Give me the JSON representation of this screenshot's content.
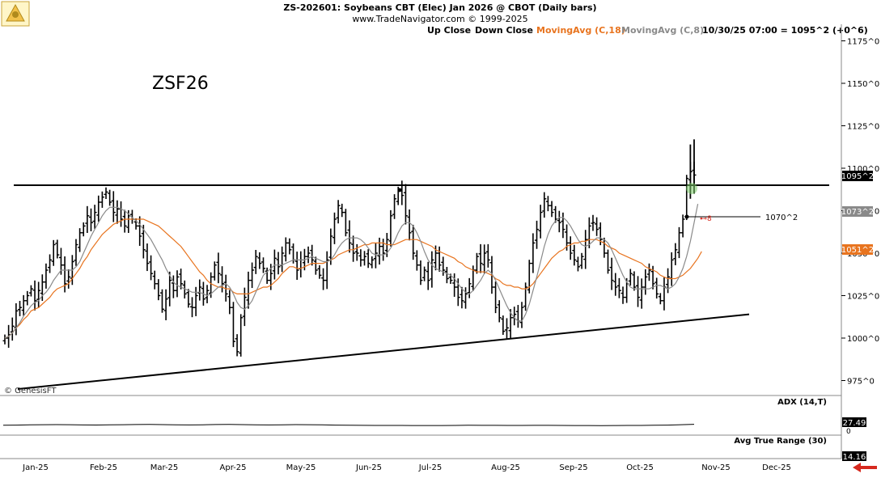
{
  "header": {
    "title": "ZS-202601:  Soybeans CBT (Elec) Jan 2026 @ CBOT  (Daily bars)",
    "subtitle": "www.TradeNavigator.com © 1999-2025"
  },
  "legend": {
    "up_close": "Up Close",
    "down_close": "Down Close",
    "ma18": "MovingAvg (C,18)",
    "ma8": "MovingAvg (C,8)",
    "last_quote": "10/30/25 07:00 = 1095^2 (+0^6)"
  },
  "colors": {
    "bars": "#000000",
    "ma18": "#e8741f",
    "ma8": "#8a8a8a",
    "adx": "#000000",
    "price_tag_bg": "#000000",
    "ma8_tag_bg": "#8a8a8a",
    "ma18_tag_bg": "#e8741f",
    "highlight": "#7ccc6a",
    "nav_arrow": "#d6291e"
  },
  "annotation_symbol": "ZSF26",
  "annotation_level": "1070^2",
  "watermark": "© GenesisFT",
  "chart_data": [
    {
      "type": "bar",
      "subtype": "ohlc",
      "title": "ZS-202601:  Soybeans CBT (Elec) Jan 2026 @ CBOT  (Daily bars)",
      "x_ticks": [
        "Jan-25",
        "Feb-25",
        "Mar-25",
        "Apr-25",
        "May-25",
        "Jun-25",
        "Jul-25",
        "Aug-25",
        "Sep-25",
        "Oct-25",
        "Nov-25",
        "Dec-25"
      ],
      "y_ticks": [
        "975^0",
        "1000^0",
        "1025^0",
        "1050^0",
        "1075^0",
        "1100^0",
        "1125^0",
        "1150^0",
        "1175^0"
      ],
      "ylim": [
        970,
        1190
      ],
      "grid": false,
      "series": [
        {
          "name": "Close",
          "values": [
            1000,
            1002,
            1007,
            1016,
            1018,
            1022,
            1025,
            1029,
            1022,
            1028,
            1033,
            1040,
            1046,
            1055,
            1049,
            1043,
            1032,
            1036,
            1045,
            1055,
            1062,
            1066,
            1072,
            1068,
            1074,
            1080,
            1083,
            1086,
            1080,
            1074,
            1076,
            1070,
            1066,
            1072,
            1070,
            1066,
            1060,
            1052,
            1044,
            1038,
            1032,
            1025,
            1017,
            1023,
            1034,
            1028,
            1036,
            1032,
            1026,
            1020,
            1018,
            1025,
            1030,
            1023,
            1028,
            1036,
            1043,
            1038,
            1032,
            1026,
            1018,
            998,
            992,
            1012,
            1024,
            1034,
            1040,
            1048,
            1044,
            1041,
            1034,
            1038,
            1047,
            1042,
            1050,
            1056,
            1052,
            1046,
            1040,
            1046,
            1048,
            1050,
            1046,
            1040,
            1037,
            1034,
            1046,
            1060,
            1070,
            1078,
            1074,
            1062,
            1056,
            1050,
            1050,
            1046,
            1048,
            1044,
            1046,
            1050,
            1054,
            1050,
            1058,
            1072,
            1082,
            1087,
            1084,
            1072,
            1062,
            1050,
            1043,
            1034,
            1040,
            1034,
            1046,
            1050,
            1043,
            1040,
            1035,
            1034,
            1030,
            1024,
            1022,
            1026,
            1032,
            1040,
            1048,
            1044,
            1050,
            1046,
            1030,
            1018,
            1012,
            1004,
            1006,
            1012,
            1014,
            1010,
            1018,
            1030,
            1044,
            1056,
            1064,
            1074,
            1082,
            1078,
            1074,
            1070,
            1068,
            1064,
            1056,
            1050,
            1046,
            1042,
            1048,
            1058,
            1066,
            1068,
            1064,
            1058,
            1050,
            1040,
            1034,
            1030,
            1028,
            1024,
            1032,
            1038,
            1030,
            1024,
            1030,
            1036,
            1040,
            1032,
            1026,
            1022,
            1030,
            1036,
            1046,
            1052,
            1062,
            1070,
            1094,
            1098,
            1096
          ],
          "color": "#000000"
        },
        {
          "name": "MovingAvg (C,18)",
          "values": [
            1000,
            1001,
            1003,
            1006,
            1008,
            1011,
            1013,
            1016,
            1017,
            1018,
            1020,
            1022,
            1024,
            1027,
            1029,
            1030,
            1031,
            1032,
            1035,
            1038,
            1041,
            1045,
            1048,
            1052,
            1055,
            1058,
            1061,
            1063,
            1065,
            1067,
            1068,
            1069,
            1070,
            1070,
            1070,
            1070,
            1070,
            1070,
            1069,
            1068,
            1067,
            1066,
            1064,
            1062,
            1060,
            1058,
            1056,
            1054,
            1051,
            1048,
            1045,
            1042,
            1039,
            1037,
            1034,
            1032,
            1031,
            1030,
            1030,
            1029,
            1029,
            1027,
            1026,
            1026,
            1026,
            1026,
            1027,
            1028,
            1029,
            1030,
            1030,
            1031,
            1033,
            1035,
            1038,
            1040,
            1042,
            1042,
            1041,
            1041,
            1042,
            1043,
            1044,
            1044,
            1044,
            1044,
            1045,
            1046,
            1047,
            1049,
            1050,
            1051,
            1052,
            1052,
            1053,
            1054,
            1055,
            1055,
            1056,
            1056,
            1056,
            1056,
            1055,
            1055,
            1055,
            1056,
            1057,
            1058,
            1058,
            1058,
            1058,
            1057,
            1056,
            1055,
            1054,
            1052,
            1051,
            1050,
            1049,
            1048,
            1047,
            1045,
            1044,
            1042,
            1041,
            1040,
            1039,
            1039,
            1039,
            1038,
            1037,
            1035,
            1034,
            1032,
            1031,
            1031,
            1030,
            1030,
            1029,
            1029,
            1030,
            1032,
            1035,
            1038,
            1041,
            1044,
            1047,
            1049,
            1051,
            1052,
            1054,
            1055,
            1056,
            1056,
            1057,
            1057,
            1058,
            1058,
            1058,
            1057,
            1056,
            1054,
            1053,
            1052,
            1050,
            1049,
            1048,
            1047,
            1046,
            1045,
            1044,
            1042,
            1041,
            1040,
            1039,
            1037,
            1036,
            1035,
            1035,
            1035,
            1036,
            1037,
            1039,
            1041,
            1044,
            1047,
            1051
          ],
          "color": "#e8741f"
        },
        {
          "name": "MovingAvg (C,8)",
          "values": [
            1000,
            1001,
            1003,
            1006,
            1009,
            1013,
            1016,
            1019,
            1021,
            1022,
            1025,
            1027,
            1030,
            1034,
            1037,
            1040,
            1040,
            1040,
            1040,
            1042,
            1045,
            1050,
            1055,
            1060,
            1064,
            1068,
            1072,
            1075,
            1077,
            1077,
            1077,
            1076,
            1075,
            1073,
            1071,
            1069,
            1067,
            1064,
            1061,
            1058,
            1054,
            1050,
            1046,
            1041,
            1037,
            1033,
            1031,
            1030,
            1029,
            1028,
            1027,
            1027,
            1027,
            1026,
            1025,
            1026,
            1028,
            1030,
            1031,
            1032,
            1030,
            1026,
            1021,
            1018,
            1017,
            1019,
            1022,
            1027,
            1032,
            1037,
            1039,
            1041,
            1043,
            1043,
            1043,
            1044,
            1045,
            1046,
            1046,
            1046,
            1046,
            1047,
            1048,
            1047,
            1046,
            1045,
            1045,
            1046,
            1049,
            1053,
            1056,
            1058,
            1059,
            1059,
            1059,
            1058,
            1056,
            1053,
            1050,
            1049,
            1049,
            1049,
            1050,
            1053,
            1057,
            1062,
            1066,
            1068,
            1068,
            1066,
            1062,
            1057,
            1051,
            1046,
            1043,
            1041,
            1040,
            1039,
            1038,
            1037,
            1035,
            1032,
            1029,
            1027,
            1026,
            1028,
            1031,
            1034,
            1038,
            1040,
            1038,
            1034,
            1029,
            1024,
            1019,
            1015,
            1012,
            1010,
            1010,
            1014,
            1020,
            1028,
            1036,
            1045,
            1054,
            1061,
            1066,
            1069,
            1071,
            1071,
            1069,
            1066,
            1062,
            1058,
            1055,
            1054,
            1055,
            1057,
            1059,
            1059,
            1058,
            1056,
            1052,
            1047,
            1042,
            1037,
            1033,
            1030,
            1029,
            1029,
            1029,
            1029,
            1029,
            1030,
            1031,
            1031,
            1030,
            1029,
            1030,
            1032,
            1036,
            1041,
            1048,
            1057,
            1068,
            1079
          ],
          "color": "#8a8a8a"
        }
      ],
      "price_tags": {
        "last": "1095^2",
        "ma8": "1073^2",
        "ma18": "1051^2"
      },
      "trendlines": [
        {
          "name": "resistance",
          "x": [
            "Jan-25",
            "Nov-25"
          ],
          "y": [
            1090,
            1090
          ]
        },
        {
          "name": "support",
          "x": [
            "Jan-25",
            "Nov-25"
          ],
          "y": [
            970,
            1014
          ]
        },
        {
          "name": "level",
          "label": "1070^2",
          "y": 1070.2
        }
      ]
    },
    {
      "type": "line",
      "title": "ADX (14,T)",
      "y_ticks": [
        "27.49",
        "0"
      ],
      "series": [
        {
          "name": "ADX (14,T)",
          "values": [
            10.2,
            10.6,
            11.2,
            11.6,
            11.8,
            11.5,
            11.0,
            10.8,
            11.2,
            11.6,
            12.0,
            12.2,
            11.8,
            11.3,
            11.0,
            11.4,
            11.9,
            12.1,
            11.7,
            11.2,
            10.9,
            11.3,
            11.7,
            11.5,
            11.1,
            10.7,
            10.4,
            10.1,
            9.9,
            9.8,
            9.8,
            9.7,
            9.6,
            9.7,
            9.9,
            10.2,
            10.1,
            10.0,
            9.9,
            9.9,
            10.0,
            10.1,
            9.9,
            9.7,
            9.6,
            9.5,
            9.6,
            9.8,
            9.9,
            10.2,
            10.6,
            11.5,
            12.6
          ]
        }
      ],
      "last_value": "27.49"
    },
    {
      "type": "line",
      "title": "Avg True Range (30)",
      "last_value": "14.16"
    }
  ]
}
